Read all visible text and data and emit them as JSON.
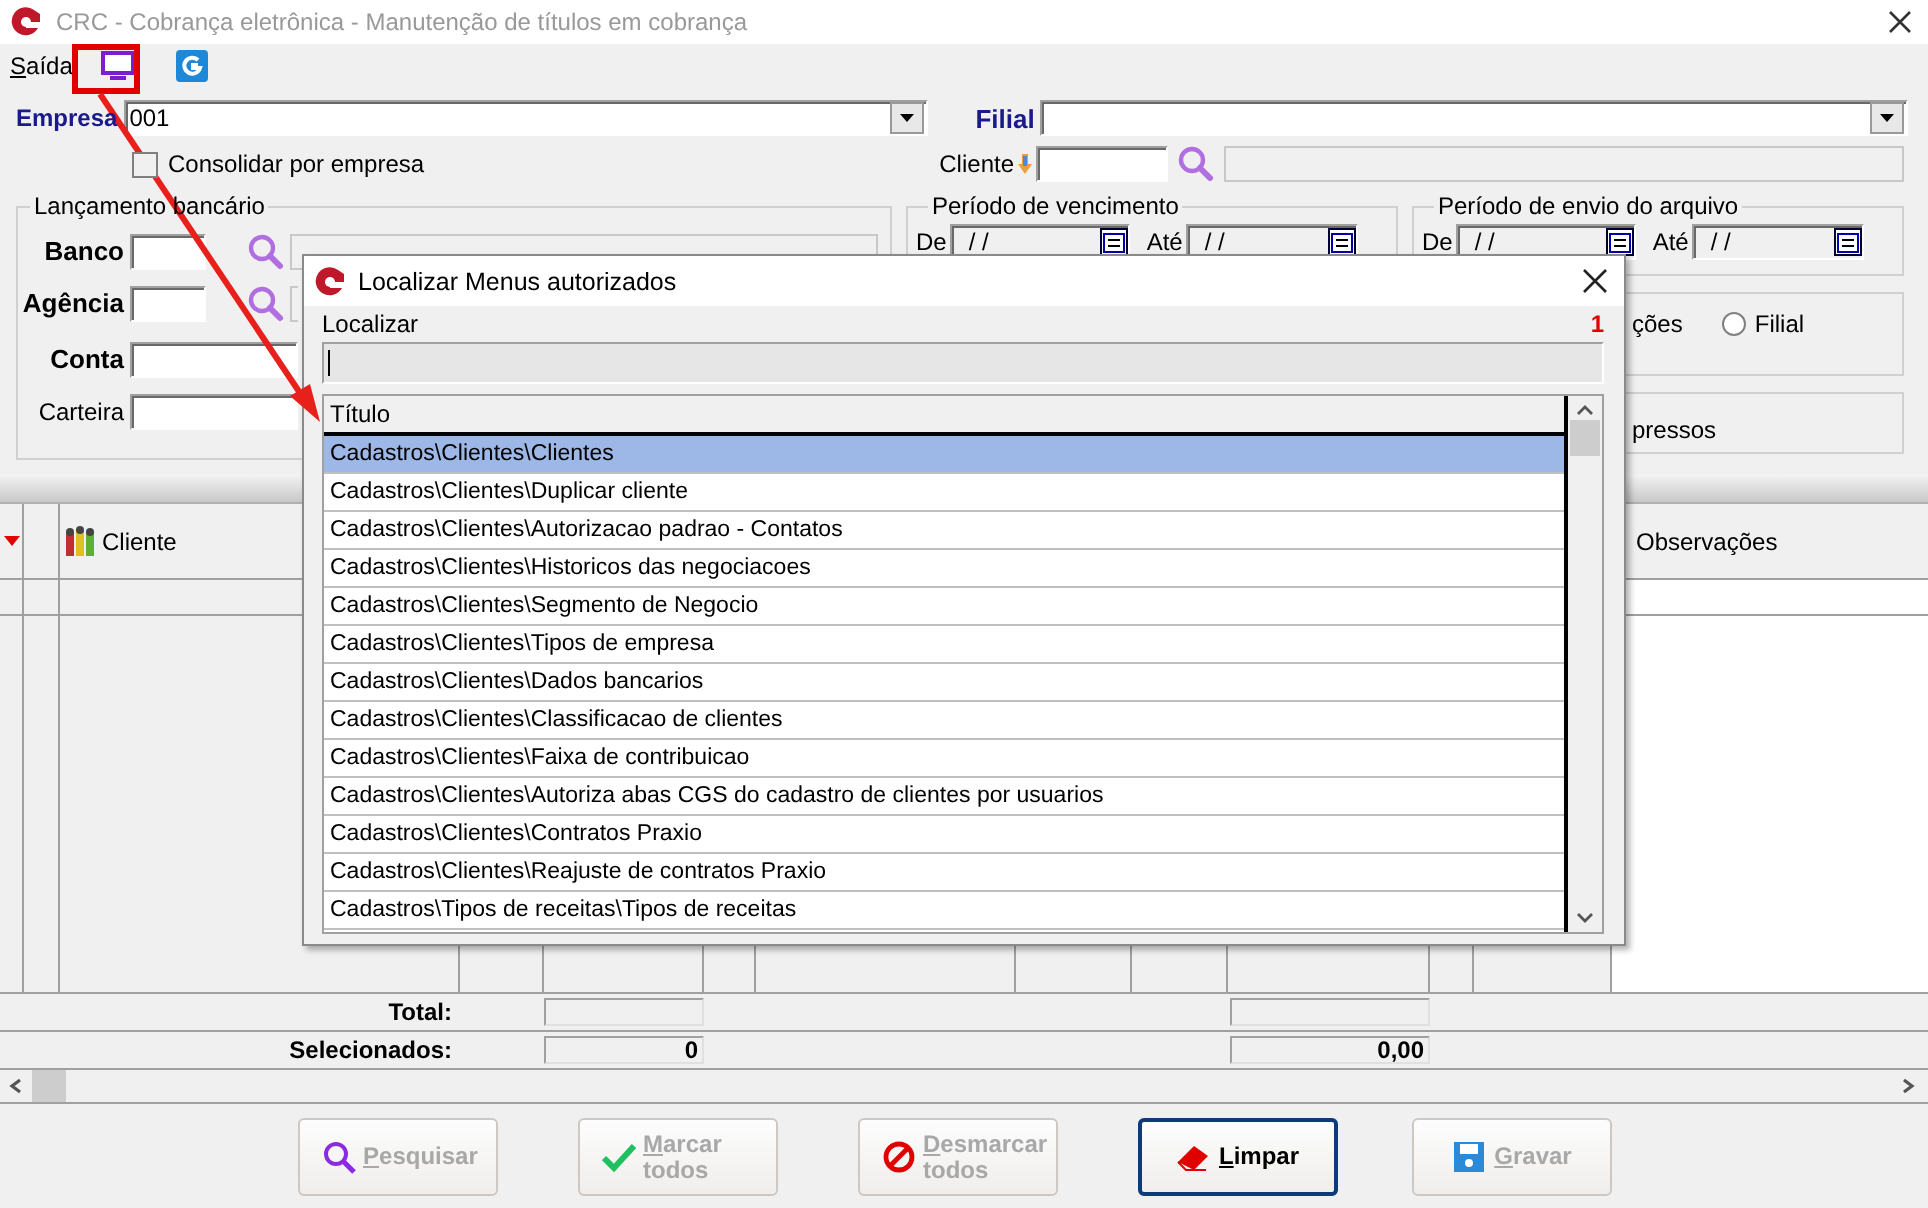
{
  "window": {
    "title": "CRC - Cobrança eletrônica - Manutenção de títulos em cobrança"
  },
  "menu": [
    {
      "label": "Saída"
    }
  ],
  "filters": {
    "empresa": {
      "label": "Empresa",
      "value": "001"
    },
    "filial": {
      "label": "Filial"
    },
    "consolidar": {
      "label": "Consolidar por empresa",
      "checked": false
    },
    "cliente": {
      "label": "Cliente"
    }
  },
  "lancamento": {
    "title": "Lançamento bancário",
    "fields": [
      {
        "label": "Banco",
        "bold": true,
        "kind": "lookup"
      },
      {
        "label": "Agência",
        "bold": true,
        "kind": "lookup"
      },
      {
        "label": "Conta",
        "bold": true,
        "kind": "text"
      },
      {
        "label": "Carteira",
        "bold": false,
        "kind": "text"
      }
    ]
  },
  "periods": [
    {
      "title": "Período de vencimento",
      "from_label": "De",
      "from_value": "/ /",
      "to_label": "Até",
      "to_value": "/ /"
    },
    {
      "title": "Período de envio do arquivo",
      "from_label": "De",
      "from_value": "/ /",
      "to_label": "Até",
      "to_value": "/ /"
    }
  ],
  "options_box": {
    "text": "ções",
    "radios": [
      {
        "label": "Filial",
        "selected": false
      }
    ]
  },
  "print_box": {
    "text": "pressos"
  },
  "grid": {
    "columns": [
      {
        "label": "Cliente"
      },
      {
        "label": "Observações"
      }
    ],
    "totals": [
      {
        "label": "Total:"
      },
      {
        "label": "Selecionados:",
        "count": "0",
        "amount": "0,00"
      }
    ]
  },
  "buttons": [
    {
      "label": "Pesquisar",
      "kind": "search",
      "disabled": true,
      "focused": false
    },
    {
      "label": "Marcar todos",
      "kind": "check",
      "disabled": true,
      "focused": false
    },
    {
      "label": "Desmarcar todos",
      "kind": "cancel",
      "disabled": true,
      "focused": false
    },
    {
      "label": "Limpar",
      "kind": "eraser",
      "disabled": false,
      "focused": true
    },
    {
      "label": "Gravar",
      "kind": "save",
      "disabled": true,
      "focused": false
    }
  ],
  "dialog": {
    "title": "Localizar Menus autorizados",
    "search_label": "Localizar",
    "count": "1",
    "column": "Título",
    "rows": [
      {
        "text": "Cadastros\\Clientes\\Clientes",
        "selected": true
      },
      {
        "text": "Cadastros\\Clientes\\Duplicar cliente",
        "selected": false
      },
      {
        "text": "Cadastros\\Clientes\\Autorizacao padrao - Contatos",
        "selected": false
      },
      {
        "text": "Cadastros\\Clientes\\Historicos das negociacoes",
        "selected": false
      },
      {
        "text": "Cadastros\\Clientes\\Segmento de Negocio",
        "selected": false
      },
      {
        "text": "Cadastros\\Clientes\\Tipos de empresa",
        "selected": false
      },
      {
        "text": "Cadastros\\Clientes\\Dados bancarios",
        "selected": false
      },
      {
        "text": "Cadastros\\Clientes\\Classificacao de clientes",
        "selected": false
      },
      {
        "text": "Cadastros\\Clientes\\Faixa de contribuicao",
        "selected": false
      },
      {
        "text": "Cadastros\\Clientes\\Autoriza abas CGS do cadastro de clientes por usuarios",
        "selected": false
      },
      {
        "text": "Cadastros\\Clientes\\Contratos Praxio",
        "selected": false
      },
      {
        "text": "Cadastros\\Clientes\\Reajuste de contratos Praxio",
        "selected": false
      },
      {
        "text": "Cadastros\\Tipos de receitas\\Tipos de receitas",
        "selected": false
      }
    ]
  }
}
